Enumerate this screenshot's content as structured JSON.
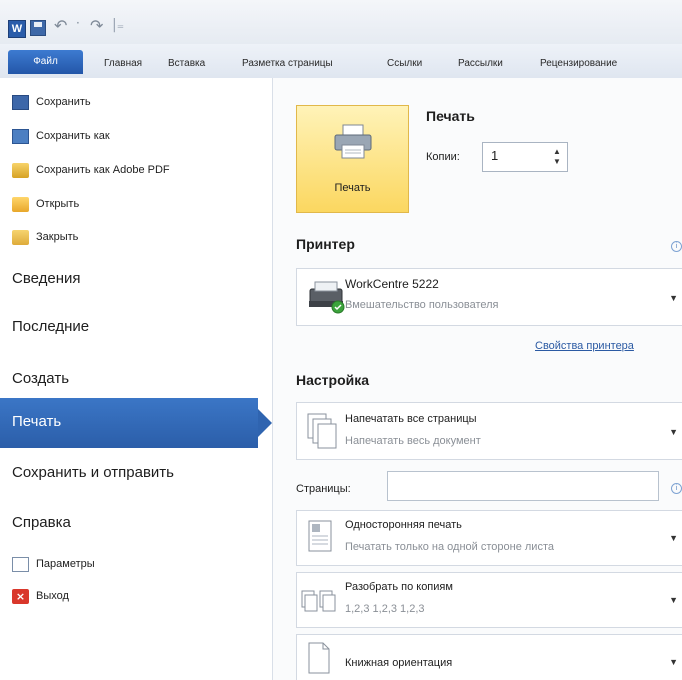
{
  "quick_access": {
    "app_icon_letter": "W",
    "icons": [
      "word-icon",
      "save-icon",
      "undo-icon",
      "redo-icon",
      "customize-icon"
    ]
  },
  "tabs": {
    "file": "Файл",
    "items": [
      "Главная",
      "Вставка",
      "Разметка страницы",
      "Ссылки",
      "Рассылки",
      "Рецензирование"
    ]
  },
  "nav": {
    "save": "Сохранить",
    "save_as": "Сохранить как",
    "save_pdf": "Сохранить как Adobe PDF",
    "open": "Открыть",
    "close": "Закрыть",
    "info": "Сведения",
    "recent": "Последние",
    "create": "Создать",
    "print": "Печать",
    "save_send": "Сохранить и отправить",
    "help": "Справка",
    "options": "Параметры",
    "exit": "Выход"
  },
  "print": {
    "button_label": "Печать",
    "title": "Печать",
    "copies_label": "Копии:",
    "copies_value": "1"
  },
  "printer": {
    "section_title": "Принтер",
    "name": "WorkCentre 5222",
    "status": "Вмешательство пользователя",
    "properties_link": "Свойства принтера"
  },
  "settings": {
    "section_title": "Настройка",
    "range_title": "Напечатать все страницы",
    "range_sub": "Напечатать весь документ",
    "pages_label": "Страницы:",
    "pages_value": "",
    "sides_title": "Односторонняя печать",
    "sides_sub": "Печатать только на одной стороне листа",
    "collate_title": "Разобрать по копиям",
    "collate_sub": "1,2,3   1,2,3   1,2,3",
    "orientation_title": "Книжная ориентация"
  },
  "colors": {
    "accent_blue": "#2b5ea9",
    "print_button_yellow": "#fbd760",
    "link_blue": "#2b5aa3"
  }
}
